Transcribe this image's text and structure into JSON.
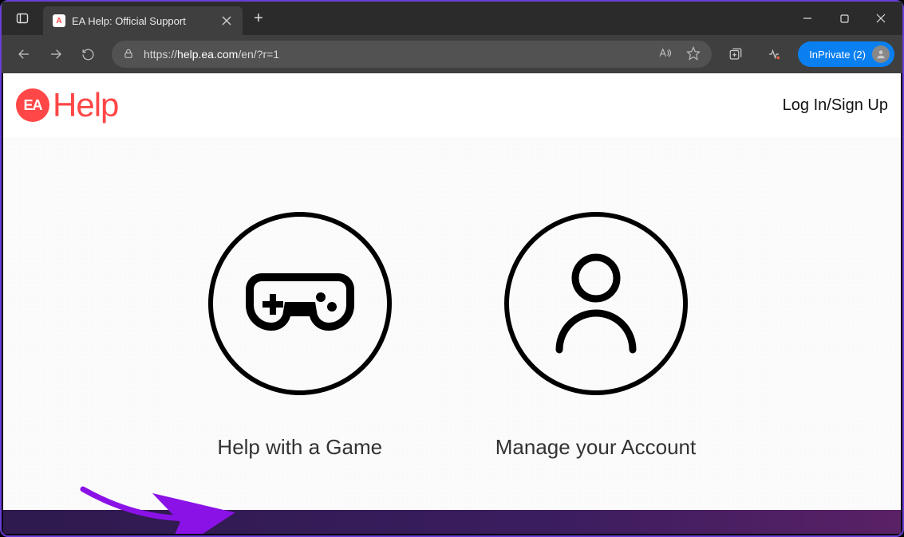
{
  "browser": {
    "tab_title": "EA Help: Official Support",
    "url_prefix": "https://",
    "url_host": "help.ea.com",
    "url_path": "/en/?r=1",
    "inprivate_label": "InPrivate (2)"
  },
  "site": {
    "logo_text": "Help",
    "logo_mark": "EA",
    "login_label": "Log In/Sign Up"
  },
  "options": {
    "game": "Help with a Game",
    "account": "Manage your Account"
  }
}
